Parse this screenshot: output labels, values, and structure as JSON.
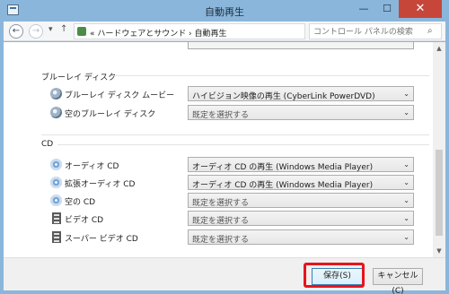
{
  "window": {
    "title": "自動再生",
    "min_glyph": "—",
    "max_glyph": "☐",
    "close_glyph": "✕"
  },
  "nav": {
    "back_glyph": "←",
    "forward_glyph": "→",
    "dropdown_glyph": "▾",
    "up_glyph": "↑",
    "address_path": "« ハードウェアとサウンド › 自動再生",
    "address_dropdown_glyph": "▾",
    "refresh_glyph": "↻",
    "search_placeholder": "コントロール パネルの検索",
    "search_glyph": "⌕"
  },
  "sections": {
    "bluray": {
      "heading": "ブルーレイ ディスク",
      "rows": [
        {
          "label": "ブルーレイ ディスク ムービー",
          "value": "ハイビジョン映像の再生 (CyberLink PowerDVD)"
        },
        {
          "label": "空のブルーレイ ディスク",
          "value": "既定を選択する"
        }
      ]
    },
    "cd": {
      "heading": "CD",
      "rows": [
        {
          "label": "オーディオ CD",
          "value": "オーディオ CD の再生 (Windows Media Player)"
        },
        {
          "label": "拡張オーディオ CD",
          "value": "オーディオ CD の再生 (Windows Media Player)"
        },
        {
          "label": "空の CD",
          "value": "既定を選択する"
        },
        {
          "label": "ビデオ CD",
          "value": "既定を選択する"
        },
        {
          "label": "スーパー ビデオ CD",
          "value": "既定を選択する"
        }
      ]
    }
  },
  "combo_arrow_glyph": "⌄",
  "scrollbar": {
    "up_glyph": "▲",
    "down_glyph": "▼"
  },
  "buttons": {
    "save_label": "保存(S)",
    "cancel_label": "キャンセル(C)"
  },
  "colors": {
    "highlight": "#e8141b",
    "close_button": "#c7463a",
    "frame": "#8bb6db"
  }
}
